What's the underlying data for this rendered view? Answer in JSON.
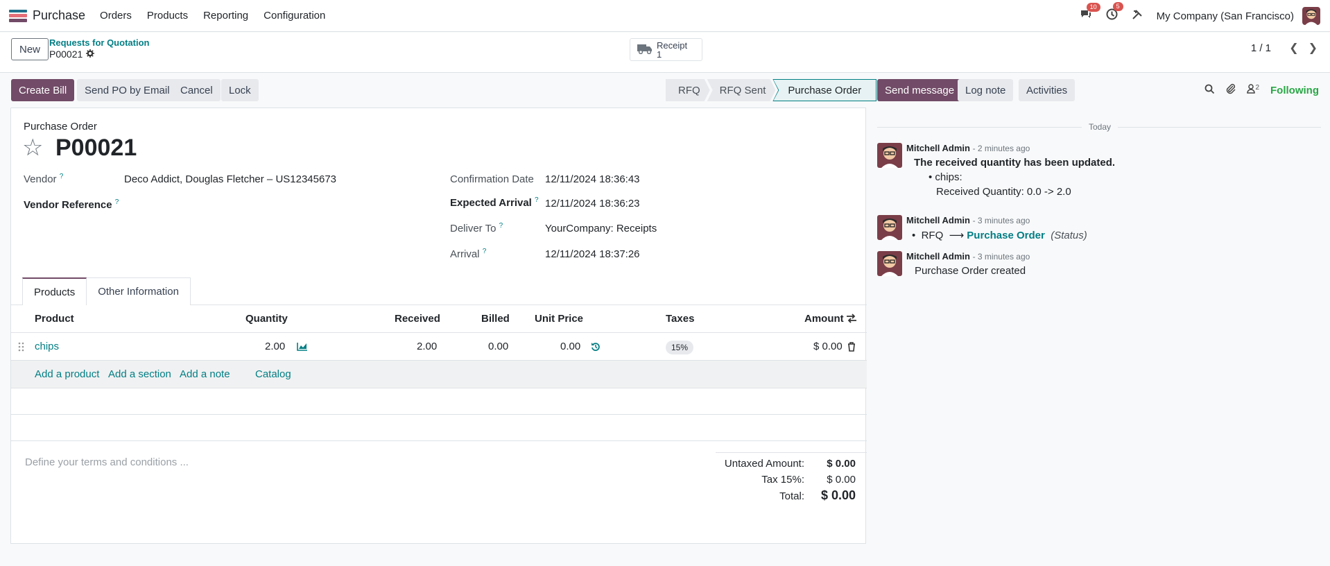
{
  "navbar": {
    "app_name": "Purchase",
    "menus": [
      "Orders",
      "Products",
      "Reporting",
      "Configuration"
    ],
    "messages_badge": "10",
    "activities_badge": "5",
    "company": "My Company (San Francisco)"
  },
  "control_panel": {
    "new_label": "New",
    "breadcrumb_parent": "Requests for Quotation",
    "breadcrumb_current": "P00021",
    "receipt_label": "Receipt",
    "receipt_count": "1",
    "pager": "1 / 1"
  },
  "actions": {
    "create_bill": "Create Bill",
    "send_po": "Send PO by Email",
    "cancel": "Cancel",
    "lock": "Lock"
  },
  "statusbar": [
    "RFQ",
    "RFQ Sent",
    "Purchase Order"
  ],
  "form": {
    "type_label": "Purchase Order",
    "name": "P00021",
    "vendor_label": "Vendor",
    "vendor_value": "Deco Addict, Douglas Fletcher – US12345673",
    "vendor_ref_label": "Vendor Reference",
    "confirmation_label": "Confirmation Date",
    "confirmation_value": "12/11/2024 18:36:43",
    "expected_label": "Expected Arrival",
    "expected_value": "12/11/2024 18:36:23",
    "deliver_label": "Deliver To",
    "deliver_value": "YourCompany: Receipts",
    "arrival_label": "Arrival",
    "arrival_value": "12/11/2024 18:37:26",
    "help_mark": "?"
  },
  "tabs": [
    "Products",
    "Other Information"
  ],
  "lines": {
    "headers": {
      "product": "Product",
      "quantity": "Quantity",
      "received": "Received",
      "billed": "Billed",
      "unit_price": "Unit Price",
      "taxes": "Taxes",
      "amount": "Amount"
    },
    "rows": [
      {
        "product": "chips",
        "quantity": "2.00",
        "received": "2.00",
        "billed": "0.00",
        "unit_price": "0.00",
        "tax": "15%",
        "amount": "$ 0.00"
      }
    ],
    "add_links": [
      "Add a product",
      "Add a section",
      "Add a note",
      "Catalog"
    ]
  },
  "terms_placeholder": "Define your terms and conditions ...",
  "totals": {
    "untaxed_label": "Untaxed Amount:",
    "untaxed_value": "$ 0.00",
    "tax_label": "Tax 15%:",
    "tax_value": "$ 0.00",
    "total_label": "Total:",
    "total_value": "$ 0.00"
  },
  "chatter": {
    "send_message": "Send message",
    "log_note": "Log note",
    "activities": "Activities",
    "followers_count": "2",
    "following": "Following",
    "today": "Today",
    "messages": [
      {
        "author": "Mitchell Admin",
        "time": "- 2 minutes ago",
        "title": "The received quantity has been updated.",
        "item": "chips:",
        "detail": "Received Quantity: 0.0 -> 2.0"
      },
      {
        "author": "Mitchell Admin",
        "time": "- 3 minutes ago",
        "from": "RFQ",
        "arrow": "⟶",
        "to": "Purchase Order",
        "field": "(Status)"
      },
      {
        "author": "Mitchell Admin",
        "time": "- 3 minutes ago",
        "body": "Purchase Order created"
      }
    ]
  },
  "colors": {
    "brand": "#714b67",
    "link": "#017e84",
    "following": "#28a745",
    "badge": "#d9534f"
  }
}
